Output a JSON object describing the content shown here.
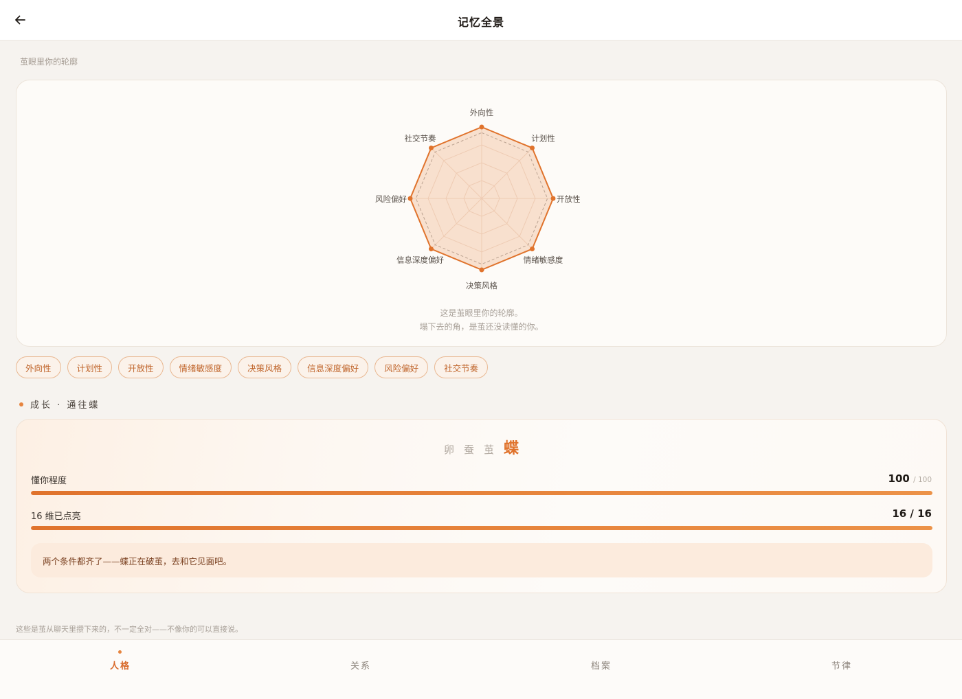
{
  "header": {
    "title": "记忆全景",
    "back_icon": "arrow-left-icon"
  },
  "profile": {
    "section_label": "茧眼里你的轮廓",
    "radar": {
      "type": "radar",
      "axes": [
        "外向性",
        "计划性",
        "开放性",
        "情绪敏感度",
        "决策风格",
        "信息深度偏好",
        "风险偏好",
        "社交节奏"
      ],
      "values": [
        1,
        1,
        1,
        1,
        1,
        1,
        1,
        1
      ],
      "range": [
        0,
        1
      ],
      "rings": 4,
      "accent_color": "#e0732c",
      "fill_color": "#f8dcc7"
    },
    "caption_line1": "这是茧眼里你的轮廓。",
    "caption_line2": "塌下去的角，是茧还没读懂的你。",
    "chips": [
      "外向性",
      "计划性",
      "开放性",
      "情绪敏感度",
      "决策风格",
      "信息深度偏好",
      "风险偏好",
      "社交节奏"
    ]
  },
  "growth": {
    "header": "成长 · 通往蝶",
    "stages": [
      "卵",
      "蚕",
      "茧"
    ],
    "current_stage": "蝶",
    "understanding": {
      "label": "懂你程度",
      "value": "100",
      "total": "/ 100",
      "fraction": 1.0
    },
    "dimensions": {
      "label": "16 维已点亮",
      "value": "16 / 16",
      "fraction": 1.0
    },
    "notice": "两个条件都齐了——蝶正在破茧，去和它见面吧。"
  },
  "footnote": "这些是茧从聊天里攒下来的，不一定全对——不像你的可以直接说。",
  "tabs": [
    {
      "label": "人格",
      "active": true
    },
    {
      "label": "关系",
      "active": false
    },
    {
      "label": "档案",
      "active": false
    },
    {
      "label": "节律",
      "active": false
    }
  ]
}
